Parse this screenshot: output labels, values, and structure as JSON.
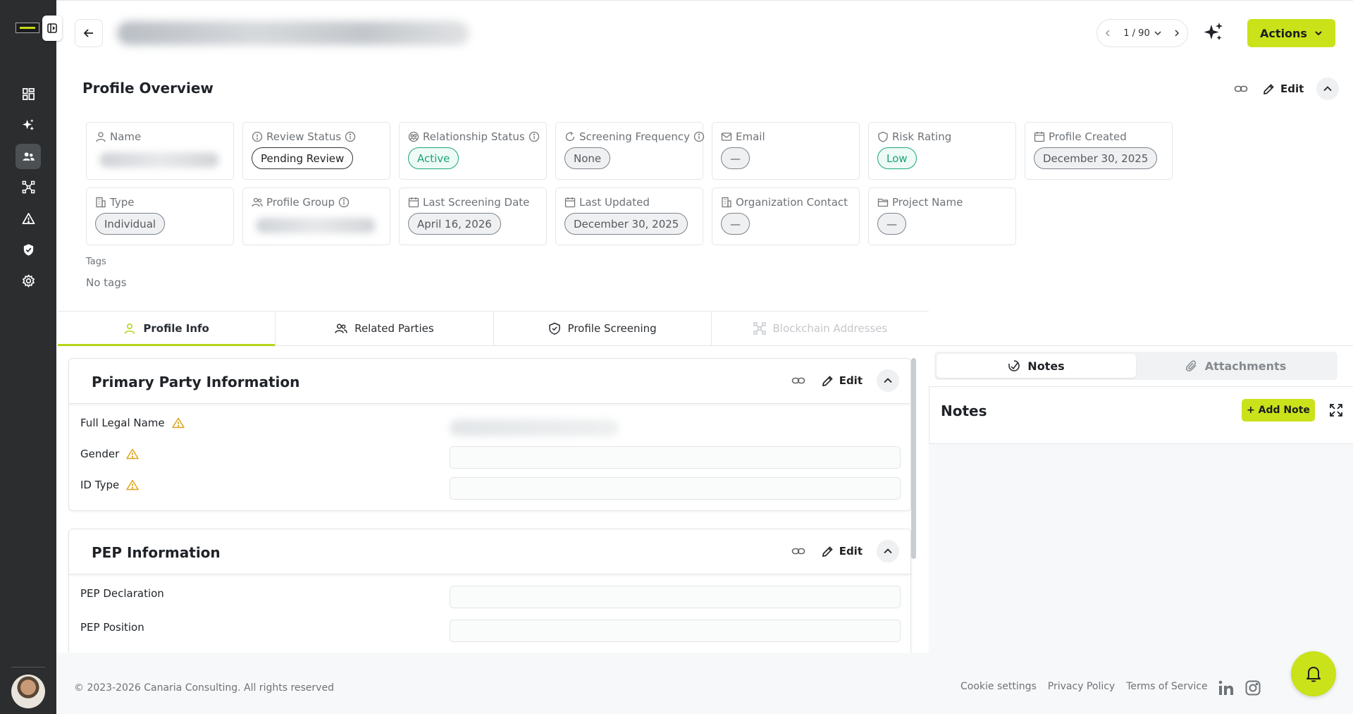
{
  "header": {
    "pager_text": "1 / 90",
    "actions_label": "Actions"
  },
  "overview": {
    "title": "Profile Overview",
    "edit_label": "Edit",
    "cards": {
      "name": {
        "label": "Name"
      },
      "review_status": {
        "label": "Review Status",
        "value": "Pending Review"
      },
      "relationship_status": {
        "label": "Relationship Status",
        "value": "Active"
      },
      "screening_frequency": {
        "label": "Screening Frequency",
        "value": "None"
      },
      "email": {
        "label": "Email",
        "value": "—"
      },
      "risk_rating": {
        "label": "Risk Rating",
        "value": "Low"
      },
      "profile_created": {
        "label": "Profile Created",
        "value": "December 30, 2025"
      },
      "type": {
        "label": "Type",
        "value": "Individual"
      },
      "profile_group": {
        "label": "Profile Group"
      },
      "last_screening_date": {
        "label": "Last Screening Date",
        "value": "April 16, 2026"
      },
      "last_updated": {
        "label": "Last Updated",
        "value": "December 30, 2025"
      },
      "organization_contact": {
        "label": "Organization Contact",
        "value": "—"
      },
      "project_name": {
        "label": "Project Name",
        "value": "—"
      }
    },
    "tags_label": "Tags",
    "tags_value": "No tags"
  },
  "tabs": [
    {
      "label": "Profile Info"
    },
    {
      "label": "Related Parties"
    },
    {
      "label": "Profile Screening"
    },
    {
      "label": "Blockchain Addresses"
    }
  ],
  "primary_party": {
    "title": "Primary Party Information",
    "edit_label": "Edit",
    "fields": [
      "Full Legal Name",
      "Gender",
      "ID Type"
    ]
  },
  "pep": {
    "title": "PEP Information",
    "edit_label": "Edit",
    "fields": [
      "PEP Declaration",
      "PEP Position"
    ]
  },
  "right_panel": {
    "tab_notes": "Notes",
    "tab_attachments": "Attachments",
    "notes_title": "Notes",
    "add_note_label": "+ Add Note"
  },
  "footer": {
    "copyright": "© 2023-2026 Canaria Consulting. All rights reserved",
    "links": [
      "Cookie settings",
      "Privacy Policy",
      "Terms of Service"
    ]
  },
  "colors": {
    "accent": "#c9e21a",
    "sidebar": "#2b2d2f",
    "status_green": "#1aa57a",
    "warning": "#e0a21a"
  }
}
